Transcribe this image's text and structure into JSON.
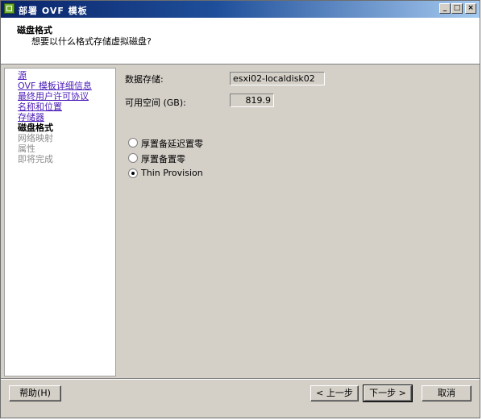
{
  "window": {
    "title": "部署 OVF 模板",
    "controls": {
      "minimize": "_",
      "maximize": "□",
      "close": "×"
    }
  },
  "header": {
    "title": "磁盘格式",
    "subtitle": "想要以什么格式存储虚拟磁盘?"
  },
  "nav": {
    "items": [
      {
        "label": "源",
        "state": "link"
      },
      {
        "label": "OVF 模板详细信息",
        "state": "link"
      },
      {
        "label": "最终用户许可协议",
        "state": "link"
      },
      {
        "label": "名称和位置",
        "state": "link"
      },
      {
        "label": "存储器",
        "state": "link"
      },
      {
        "label": "磁盘格式",
        "state": "current"
      },
      {
        "label": "网络映射",
        "state": "disabled"
      },
      {
        "label": "属性",
        "state": "disabled"
      },
      {
        "label": "即将完成",
        "state": "disabled"
      }
    ]
  },
  "form": {
    "datastore_label": "数据存储:",
    "datastore_value": "esxi02-localdisk02",
    "free_space_label": "可用空间 (GB):",
    "free_space_value": "819.9",
    "options": [
      {
        "label": "厚置备延迟置零",
        "checked": false
      },
      {
        "label": "厚置备置零",
        "checked": false
      },
      {
        "label": "Thin Provision",
        "checked": true
      }
    ]
  },
  "buttons": {
    "help": "帮助(H)",
    "back": "< 上一步",
    "next": "下一步 >",
    "cancel": "取消"
  },
  "colors": {
    "link": "#4a1ab8",
    "disabled": "#8c8c8c",
    "title_gradient_start": "#0a246a",
    "title_gradient_end": "#a6caf0",
    "face": "#d4d0c8"
  }
}
